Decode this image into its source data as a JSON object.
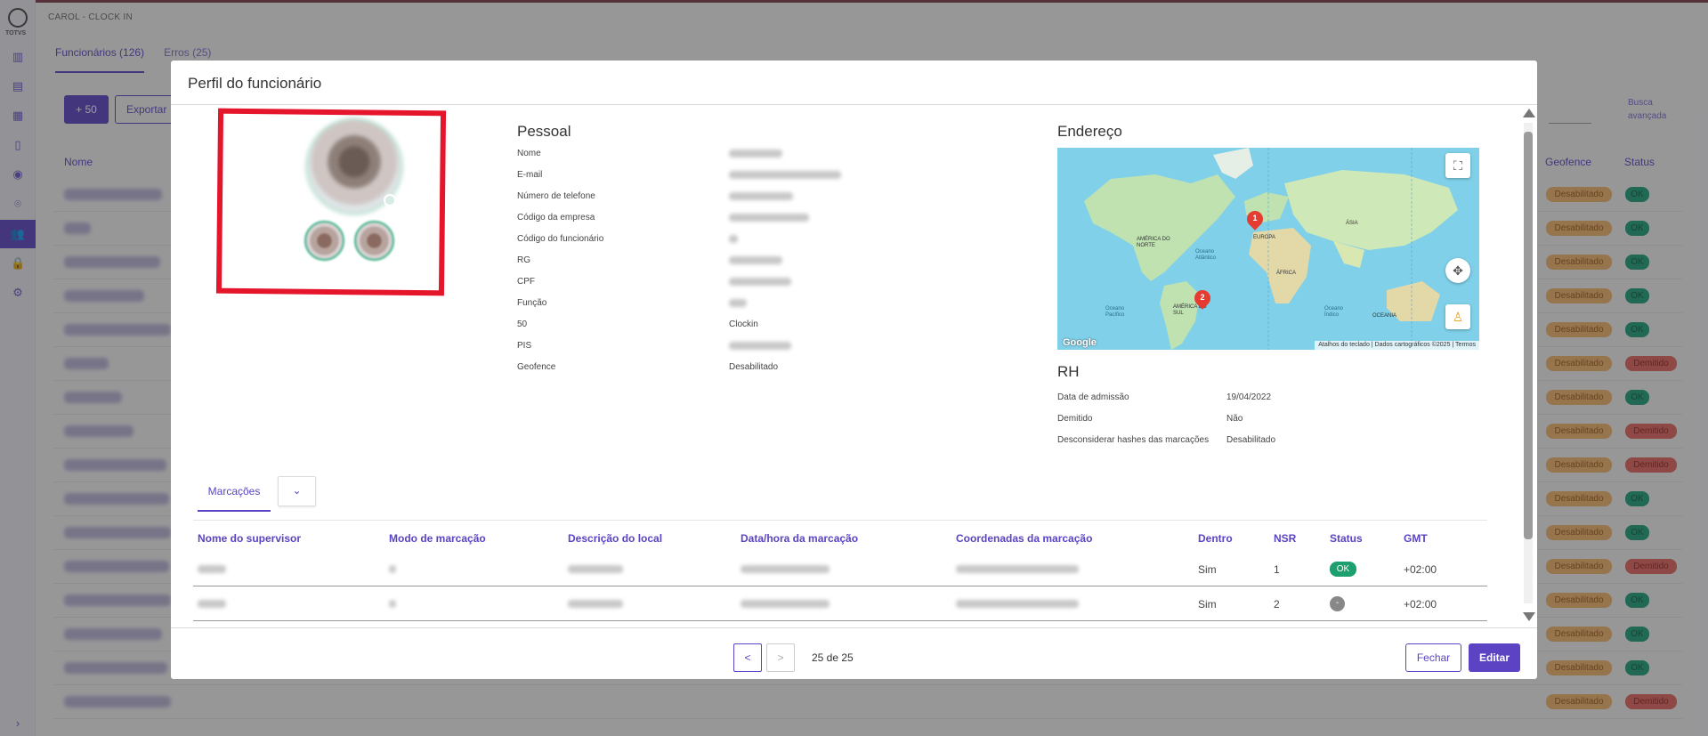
{
  "app": {
    "title": "CAROL - CLOCK IN",
    "logo_text": "TOTVS",
    "tabs": [
      {
        "label": "Funcionários (126)"
      },
      {
        "label": "Erros (25)"
      }
    ],
    "plus50_label": "+ 50",
    "export_label": "Exportar",
    "advanced_search_label": "Busca avançada",
    "columns": {
      "name": "Nome",
      "geofence": "Geofence",
      "status": "Status"
    },
    "geofence_badge": "Desabilitado",
    "status_ok": "OK",
    "status_bad": "Demitido"
  },
  "modal": {
    "title": "Perfil do funcionário",
    "pessoal": {
      "title": "Pessoal",
      "fields": [
        {
          "label": "Nome",
          "value": ""
        },
        {
          "label": "E-mail",
          "value": ""
        },
        {
          "label": "Número de telefone",
          "value": ""
        },
        {
          "label": "Código da empresa",
          "value": ""
        },
        {
          "label": "Código do funcionário",
          "value": ""
        },
        {
          "label": "RG",
          "value": ""
        },
        {
          "label": "CPF",
          "value": ""
        },
        {
          "label": "Função",
          "value": ""
        },
        {
          "label": "50",
          "value": "Clockin"
        },
        {
          "label": "PIS",
          "value": ""
        },
        {
          "label": "Geofence",
          "value": "Desabilitado"
        }
      ]
    },
    "endereco": {
      "title": "Endereço",
      "map": {
        "labels": [
          "AMÉRICA DO NORTE",
          "Oceano Atlântico",
          "EUROPA",
          "ÁSIA",
          "ÁFRICA",
          "Oceano Pacífico",
          "AMÉRICA DO SUL",
          "Oceano Índico",
          "OCEANIA"
        ],
        "markers": [
          "1",
          "2"
        ],
        "footer": "Atalhos do teclado | Dados cartográficos ©2025 | Termos",
        "logo": "Google"
      }
    },
    "rh": {
      "title": "RH",
      "fields": [
        {
          "label": "Data de admissão",
          "value": "19/04/2022"
        },
        {
          "label": "Demitido",
          "value": "Não"
        },
        {
          "label": "Desconsiderar hashes das marcações",
          "value": "Desabilitado"
        }
      ]
    },
    "tab_marcacoes": "Marcações",
    "table": {
      "headers": [
        "Nome do supervisor",
        "Modo de marcação",
        "Descrição do local",
        "Data/hora da marcação",
        "Coordenadas da marcação",
        "Dentro",
        "NSR",
        "Status",
        "GMT"
      ],
      "rows": [
        {
          "dentro": "Sim",
          "nsr": "1",
          "status": "OK",
          "gmt": "+02:00"
        },
        {
          "dentro": "Sim",
          "nsr": "2",
          "status": "-",
          "gmt": "+02:00"
        }
      ]
    },
    "pagination": {
      "prev": "<",
      "next": ">",
      "text": "25 de 25"
    },
    "close_label": "Fechar",
    "edit_label": "Editar"
  }
}
